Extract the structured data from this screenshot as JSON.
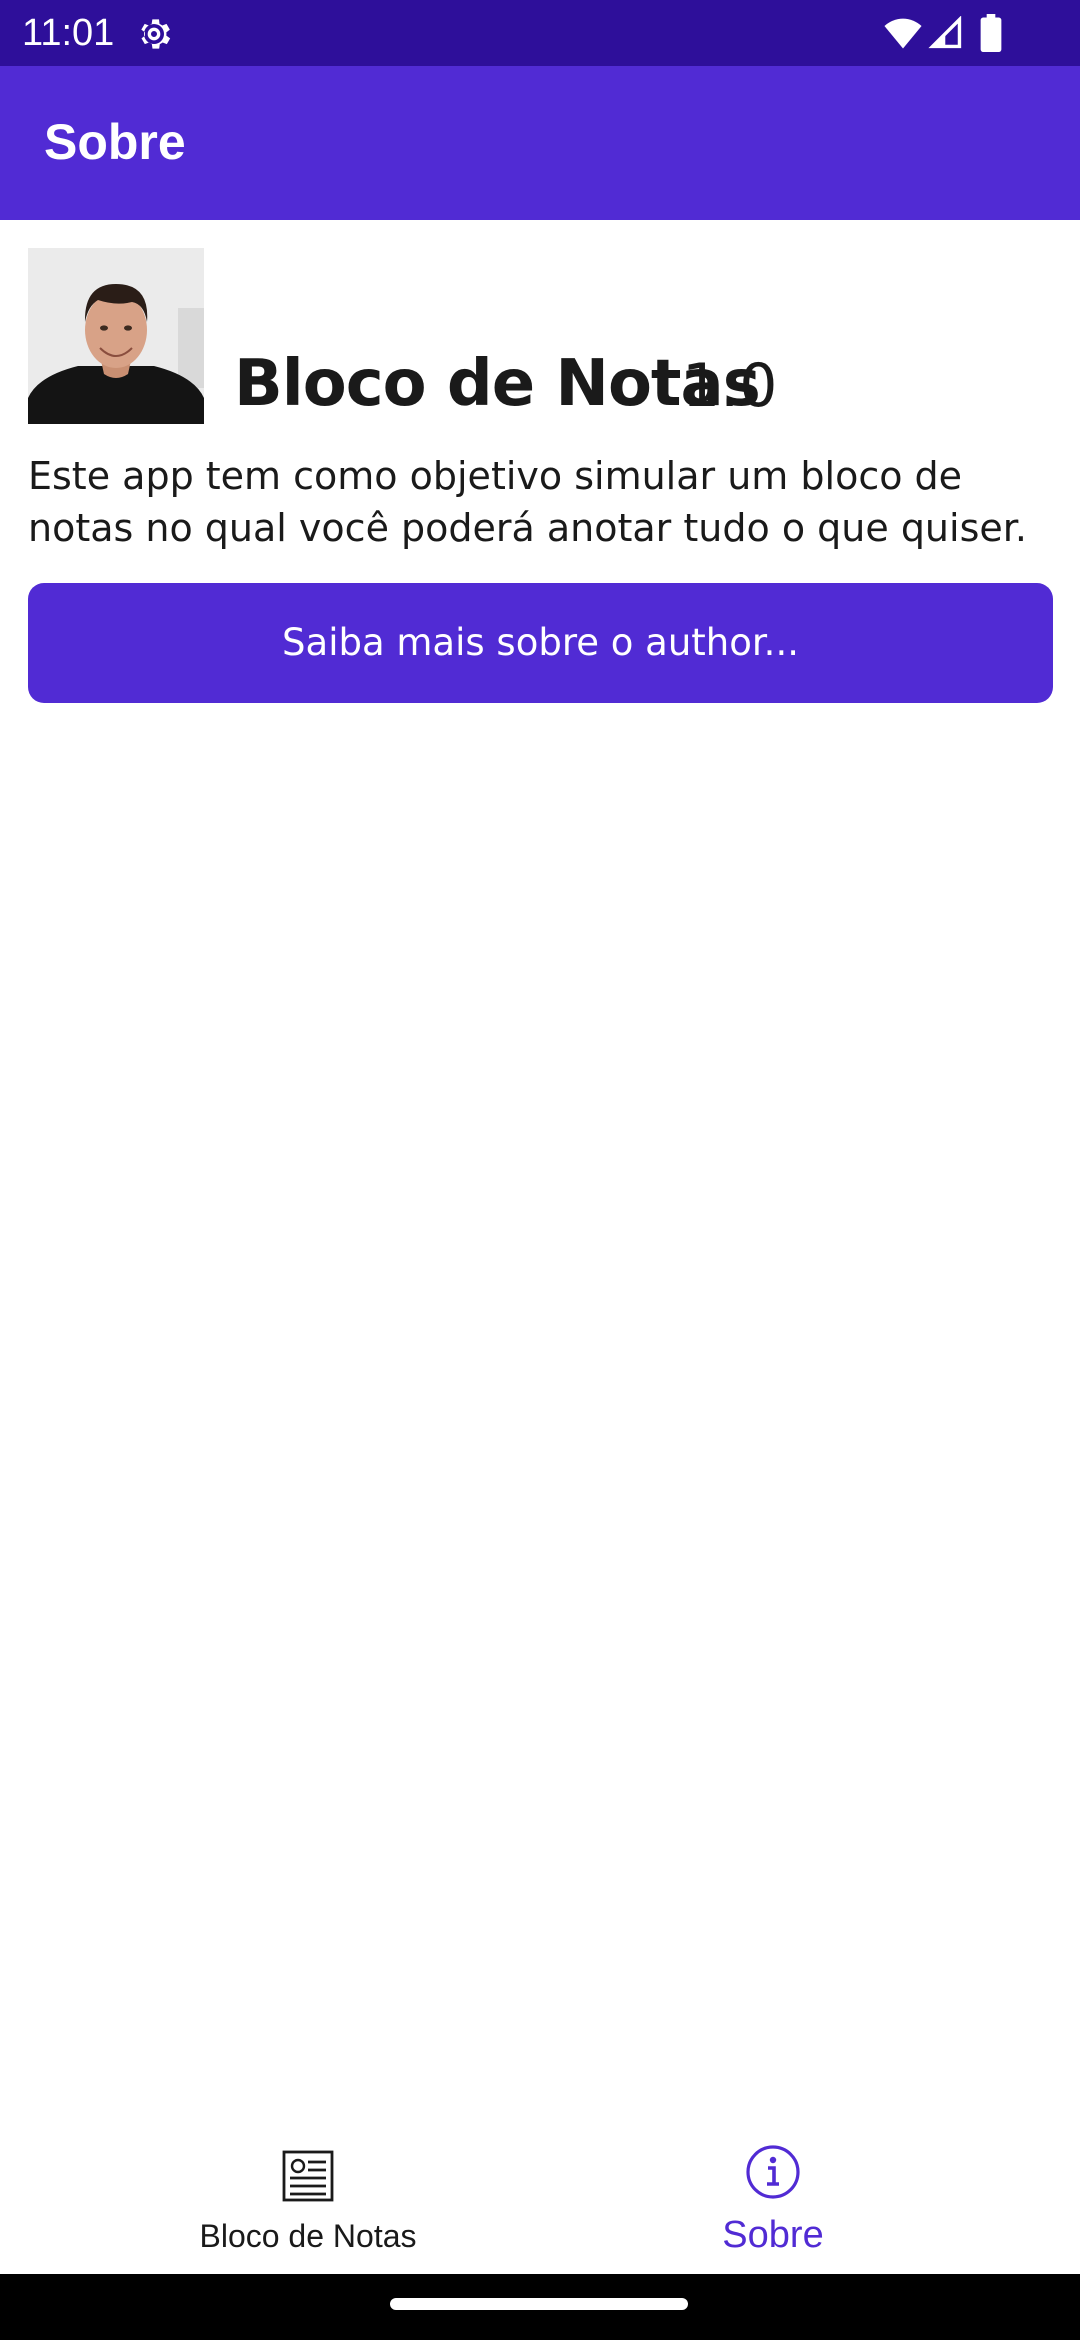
{
  "status_bar": {
    "time": "11:01",
    "icons": [
      "gear-icon",
      "wifi-icon",
      "signal-icon",
      "battery-icon"
    ]
  },
  "app_bar": {
    "title": "Sobre"
  },
  "about": {
    "app_name": "Bloco de Notas",
    "version": "1.0",
    "description": "Este app tem como objetivo simular um bloco de notas no qual você poderá anotar tudo o que quiser.",
    "author_button_label": "Saiba mais sobre o author..."
  },
  "bottom_nav": {
    "items": [
      {
        "label": "Bloco de Notas",
        "icon": "notes-icon",
        "selected": false
      },
      {
        "label": "Sobre",
        "icon": "info-icon",
        "selected": true
      }
    ]
  },
  "colors": {
    "status_bar": "#2e0f9a",
    "primary": "#512bd4",
    "text": "#1a1a1a"
  }
}
